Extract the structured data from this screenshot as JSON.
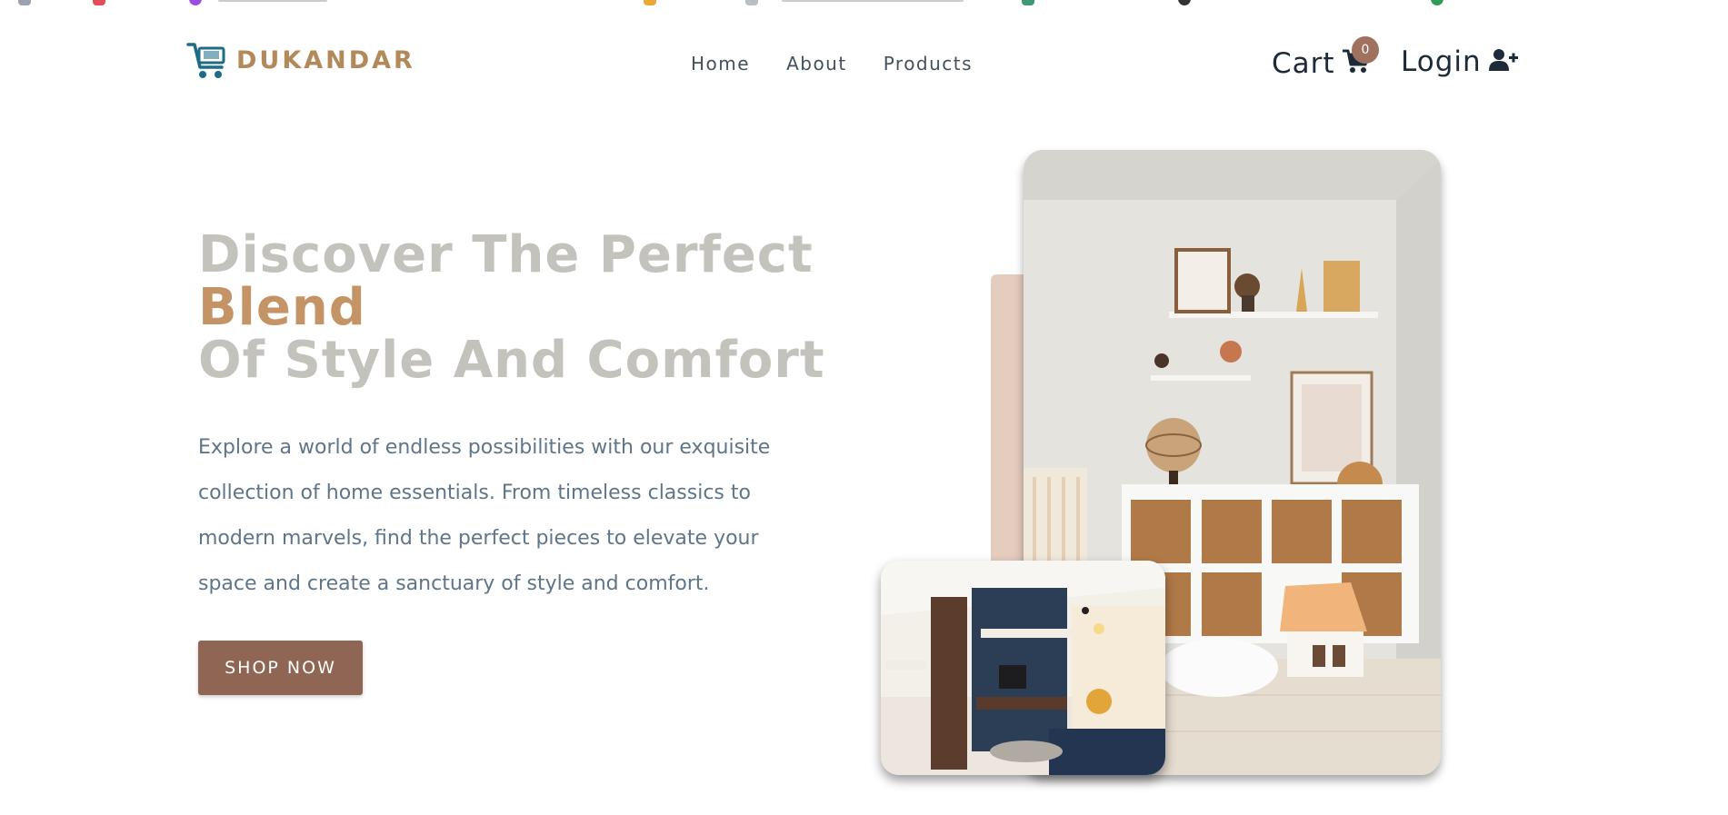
{
  "brand": {
    "name": "DUKANDAR",
    "logo_color": "#b1895b",
    "logo_icon_color": "#1d6b86"
  },
  "nav": {
    "links": [
      {
        "label": "Home"
      },
      {
        "label": "About"
      },
      {
        "label": "Products"
      }
    ],
    "cart": {
      "label": "Cart",
      "count": "0",
      "icon": "shopping-cart-icon"
    },
    "login": {
      "label": "Login",
      "icon": "user-plus-icon"
    }
  },
  "hero": {
    "title_line1": "Discover The Perfect",
    "title_accent": "Blend",
    "title_line3": "Of Style And Comfort",
    "description": "Explore a world of endless possibilities with our exquisite collection of home essentials. From timeless classics to modern marvels, find the perfect pieces to elevate your space and create a sanctuary of style and comfort.",
    "cta_label": "SHOP NOW"
  },
  "colors": {
    "title_gray": "#c3c2bd",
    "title_accent": "#c59466",
    "description": "#5f7588",
    "button_bg": "#8f6553",
    "badge_bg": "#a0715e",
    "accent_block": "#e4ccbe"
  }
}
